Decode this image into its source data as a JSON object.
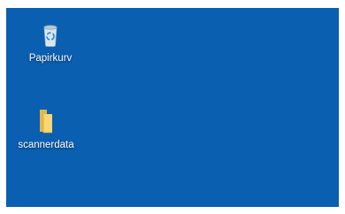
{
  "desktop": {
    "background_color": "#0a5fb0",
    "icons": [
      {
        "label": "Papirkurv",
        "icon": "recycle-bin-icon"
      },
      {
        "label": "scannerdata",
        "icon": "folder-icon"
      }
    ]
  }
}
